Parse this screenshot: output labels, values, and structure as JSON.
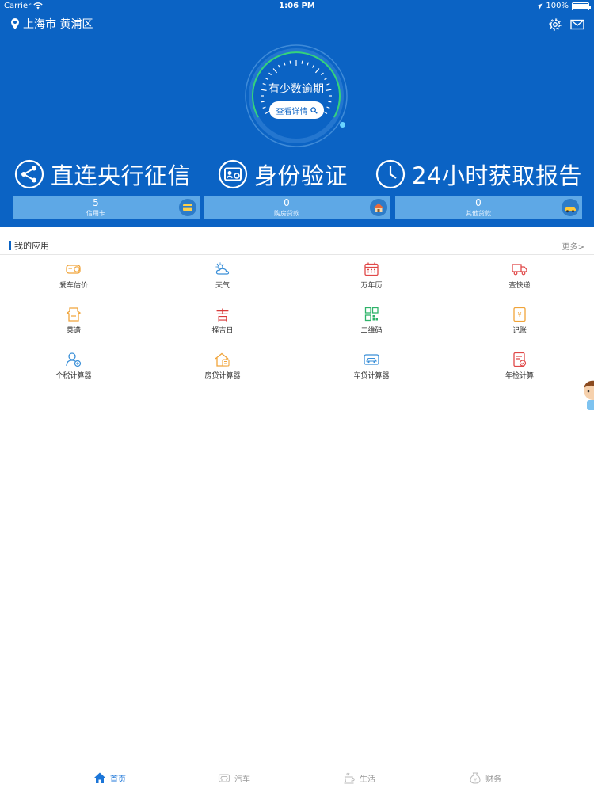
{
  "status_bar": {
    "carrier": "Carrier",
    "time": "1:06 PM",
    "battery": "100%",
    "battery_level": 1.0
  },
  "header": {
    "location": "上海市 黄浦区",
    "icons": [
      "location-pin-icon",
      "gear-icon",
      "mail-icon"
    ]
  },
  "gauge": {
    "status_text": "有少数逾期",
    "detail_button": "查看详情"
  },
  "features": [
    {
      "icon": "share-icon",
      "label": "直连央行征信"
    },
    {
      "icon": "id-card-icon",
      "label": "身份验证"
    },
    {
      "icon": "clock-icon",
      "label": "24小时获取报告"
    }
  ],
  "stats": [
    {
      "value": "5",
      "label": "信用卡",
      "icon": "credit-card-icon"
    },
    {
      "value": "0",
      "label": "购房贷款",
      "icon": "house-icon"
    },
    {
      "value": "0",
      "label": "其他贷款",
      "icon": "car-icon"
    }
  ],
  "apps_section": {
    "title": "我的应用",
    "more": "更多>",
    "items": [
      {
        "label": "爱车估价",
        "icon": "car-value-icon",
        "color": "#f0a43a"
      },
      {
        "label": "天气",
        "icon": "weather-icon",
        "color": "#3a8fd8"
      },
      {
        "label": "万年历",
        "icon": "calendar-icon",
        "color": "#e04848"
      },
      {
        "label": "查快递",
        "icon": "truck-icon",
        "color": "#e04848"
      },
      {
        "label": "菜谱",
        "icon": "apron-icon",
        "color": "#f0a43a"
      },
      {
        "label": "择吉日",
        "icon": "lucky-day-icon",
        "color": "#d83a3a",
        "glyph": "吉"
      },
      {
        "label": "二维码",
        "icon": "qr-code-icon",
        "color": "#2fb36a"
      },
      {
        "label": "记账",
        "icon": "ledger-icon",
        "color": "#f0a43a"
      },
      {
        "label": "个税计算器",
        "icon": "tax-person-icon",
        "color": "#3a8fd8"
      },
      {
        "label": "房贷计算器",
        "icon": "house-loan-icon",
        "color": "#f0a43a"
      },
      {
        "label": "车贷计算器",
        "icon": "car-loan-icon",
        "color": "#3a8fd8"
      },
      {
        "label": "年检计算",
        "icon": "inspection-icon",
        "color": "#e04848"
      }
    ]
  },
  "tabbar": [
    {
      "label": "首页",
      "icon": "home-icon",
      "active": true
    },
    {
      "label": "汽车",
      "icon": "car-tab-icon",
      "active": false
    },
    {
      "label": "生活",
      "icon": "coffee-icon",
      "active": false
    },
    {
      "label": "财务",
      "icon": "money-bag-icon",
      "active": false
    }
  ],
  "colors": {
    "primary": "#0b63c4",
    "stat_bg": "#5ea8e6",
    "gauge_green": "#34d47a",
    "tab_active": "#1c76d8",
    "tab_inactive": "#999999"
  }
}
